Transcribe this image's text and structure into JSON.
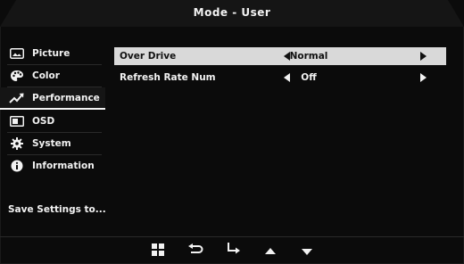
{
  "header": {
    "title": "Mode - User"
  },
  "sidebar": {
    "items": [
      {
        "label": "Picture",
        "icon": "picture-icon",
        "active": false
      },
      {
        "label": "Color",
        "icon": "palette-icon",
        "active": false
      },
      {
        "label": "Performance",
        "icon": "trend-up-icon",
        "active": true
      },
      {
        "label": "OSD",
        "icon": "osd-icon",
        "active": false
      },
      {
        "label": "System",
        "icon": "gear-icon",
        "active": false
      },
      {
        "label": "Information",
        "icon": "info-icon",
        "active": false
      }
    ],
    "save_settings": "Save Settings to..."
  },
  "settings": [
    {
      "label": "Over Drive",
      "value": "Normal",
      "selected": true
    },
    {
      "label": "Refresh Rate Num",
      "value": "Off",
      "selected": false
    }
  ],
  "bottom_buttons": [
    {
      "icon": "menu-icon"
    },
    {
      "icon": "back-icon"
    },
    {
      "icon": "enter-icon"
    },
    {
      "icon": "up-icon"
    },
    {
      "icon": "down-icon"
    }
  ],
  "colors": {
    "background": "#0b0b0b",
    "highlight": "#d9d9d9",
    "text": "#f2f2f2"
  }
}
